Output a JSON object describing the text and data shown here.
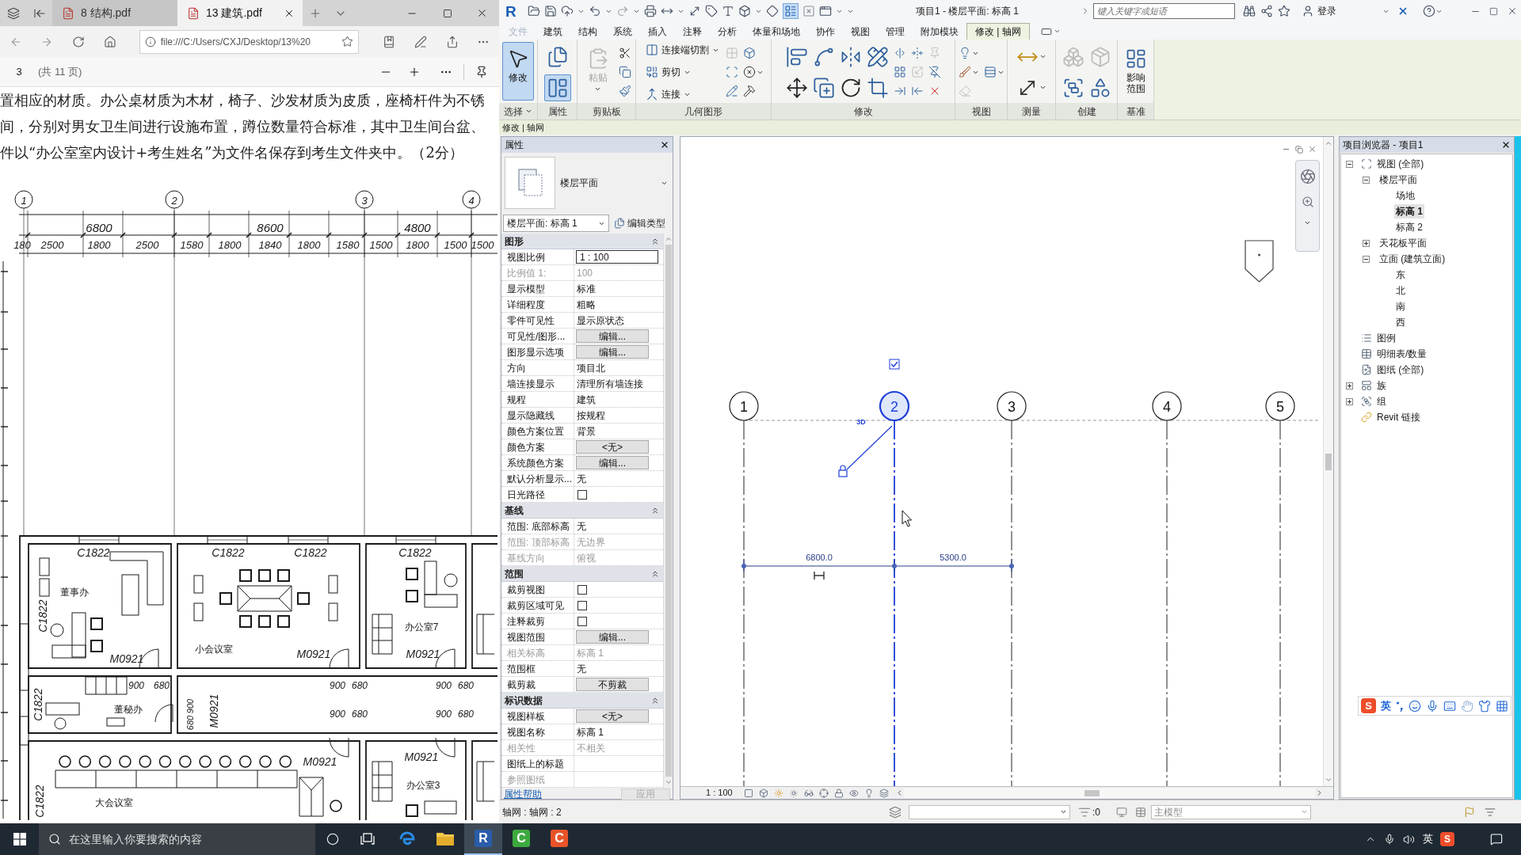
{
  "pdf_window": {
    "tabs": [
      {
        "label": "8 结构.pdf",
        "selected": false
      },
      {
        "label": "13 建筑.pdf",
        "selected": true
      }
    ],
    "address": "file:///C:/Users/CXJ/Desktop/13%20",
    "page": "3",
    "page_count": "(共 11 页)",
    "paragraph": [
      "置相应的材质。办公桌材质为木材，椅子、沙发材质为皮质，座椅杆件为不锈",
      "间，分别对男女卫生间进行设施布置，蹲位数量符合标准，其中卫生间台盆、",
      "件以“办公室室内设计+考生姓名”为文件名保存到考生文件夹中。（2分）"
    ],
    "plan": {
      "grid_bubbles": [
        "1",
        "2",
        "3",
        "4"
      ],
      "overall_dimensions": [
        "6800",
        "8600",
        "4800"
      ],
      "detail_dimensions": [
        "180",
        "2500",
        "1800",
        "2500",
        "1580",
        "1800",
        "1840",
        "1800",
        "1580",
        "1500",
        "1800",
        "1500",
        "1500"
      ],
      "labels": [
        "C1822",
        "C1822",
        "C1822",
        "C1822",
        "董事办",
        "C1822",
        "办公室7",
        "小会议室",
        "M0921",
        "M0921",
        "M0921",
        "900",
        "680",
        "900",
        "680",
        "900",
        "680",
        "C1822",
        "董秘办",
        "M0921",
        "900",
        "680",
        "900",
        "680",
        "900",
        "680",
        "M0921",
        "M0921",
        "办公室3",
        "大会议室",
        "C1822"
      ]
    }
  },
  "revit": {
    "logo": "R",
    "title": "项目1 - 楼层平面: 标高 1",
    "thin_lines_on": true,
    "search": {
      "placeholder": "键入关键字或短语"
    },
    "sign_in": "登录",
    "tabs": [
      {
        "label": "文件",
        "kind": "menu",
        "selected": false
      },
      {
        "label": "建筑",
        "kind": "tab",
        "selected": false
      },
      {
        "label": "结构",
        "kind": "tab",
        "selected": false
      },
      {
        "label": "系统",
        "kind": "tab",
        "selected": false
      },
      {
        "label": "插入",
        "kind": "tab",
        "selected": false
      },
      {
        "label": "注释",
        "kind": "tab",
        "selected": false
      },
      {
        "label": "分析",
        "kind": "tab",
        "selected": false
      },
      {
        "label": "体量和场地",
        "kind": "tab",
        "selected": false
      },
      {
        "label": "协作",
        "kind": "tab",
        "selected": false
      },
      {
        "label": "视图",
        "kind": "tab",
        "selected": false
      },
      {
        "label": "管理",
        "kind": "tab",
        "selected": false
      },
      {
        "label": "附加模块",
        "kind": "tab",
        "selected": false
      },
      {
        "label": "修改 | 轴网",
        "kind": "contextual",
        "selected": true
      }
    ],
    "panels": [
      {
        "label": "选择",
        "menu": true,
        "tools": [
          {
            "kind": "pointer",
            "label": "修改",
            "selected": true
          }
        ]
      },
      {
        "label": "属性",
        "menu": false,
        "tools": [
          {
            "kind": "type-properties",
            "selected": false
          },
          {
            "kind": "properties",
            "selected": true
          }
        ]
      },
      {
        "label": "剪贴板",
        "menu": false,
        "tools": [
          {
            "kind": "paste",
            "label": "粘贴",
            "disabled": true,
            "menu": true
          },
          {
            "kind": "cut",
            "disabled": false,
            "menu": false
          },
          {
            "kind": "copy",
            "disabled": false,
            "menu": false
          },
          {
            "kind": "match",
            "disabled": false,
            "menu": false
          }
        ]
      },
      {
        "label": "几何图形",
        "menu": false,
        "tools": [
          {
            "kind": "cope",
            "label": "连接端切割",
            "disabled": false,
            "menu": true
          },
          {
            "kind": "cut-geometry",
            "label": "剪切",
            "disabled": false,
            "menu": true
          },
          {
            "kind": "join",
            "label": "连接",
            "disabled": false,
            "menu": true
          },
          {
            "kind": "wall-joins",
            "disabled": true,
            "menu": false
          },
          {
            "kind": "split-face",
            "disabled": false,
            "menu": false
          },
          {
            "kind": "paint",
            "disabled": false,
            "menu": false
          },
          {
            "kind": "cube",
            "disabled": false,
            "menu": false
          },
          {
            "kind": "remove",
            "disabled": false,
            "menu": true
          },
          {
            "kind": "demolish",
            "disabled": false,
            "menu": false
          }
        ]
      },
      {
        "label": "修改",
        "menu": false,
        "tools": [
          {
            "kind": "align",
            "disabled": false,
            "menu": false
          },
          {
            "kind": "move",
            "disabled": false,
            "menu": false
          },
          {
            "kind": "offset",
            "disabled": false,
            "menu": false
          },
          {
            "kind": "copy-move",
            "disabled": false,
            "menu": false
          },
          {
            "kind": "mirror-axis",
            "disabled": false,
            "menu": false
          },
          {
            "kind": "rotate",
            "disabled": false,
            "menu": false
          },
          {
            "kind": "mirror-line",
            "disabled": false,
            "menu": false
          },
          {
            "kind": "trim",
            "disabled": false,
            "menu": false
          },
          {
            "kind": "split",
            "disabled": false,
            "menu": false
          },
          {
            "kind": "array",
            "disabled": false,
            "menu": false
          },
          {
            "kind": "trim-multi",
            "disabled": false,
            "menu": false
          },
          {
            "kind": "split-gap",
            "disabled": false,
            "menu": false
          },
          {
            "kind": "scale",
            "disabled": true,
            "menu": false
          },
          {
            "kind": "extend",
            "disabled": false,
            "menu": false
          },
          {
            "kind": "pin",
            "disabled": true,
            "menu": false
          },
          {
            "kind": "unpin",
            "disabled": false,
            "menu": false
          },
          {
            "kind": "delete",
            "disabled": false,
            "menu": false
          }
        ]
      },
      {
        "label": "视图",
        "menu": false,
        "tools": [
          {
            "kind": "bulb",
            "disabled": false,
            "menu": true
          },
          {
            "kind": "brush",
            "disabled": false,
            "menu": true
          },
          {
            "kind": "eraser",
            "disabled": true,
            "menu": false
          },
          {
            "kind": "lines",
            "disabled": false,
            "menu": true
          }
        ]
      },
      {
        "label": "测量",
        "menu": false,
        "tools": [
          {
            "kind": "measure",
            "disabled": false,
            "menu": true
          },
          {
            "kind": "dimension",
            "disabled": false,
            "menu": true
          }
        ]
      },
      {
        "label": "创建",
        "menu": false,
        "tools": [
          {
            "kind": "parts",
            "disabled": true,
            "menu": false
          },
          {
            "kind": "group",
            "disabled": false,
            "menu": false
          },
          {
            "kind": "assembly",
            "disabled": true,
            "menu": false
          },
          {
            "kind": "similar",
            "disabled": false,
            "menu": false
          }
        ]
      },
      {
        "label": "基准",
        "menu": false,
        "tools": [
          {
            "kind": "scope",
            "label": "影响范围",
            "disabled": false,
            "menu": false
          }
        ]
      }
    ],
    "context_label": "修改 | 轴网",
    "properties": {
      "title": "属性",
      "type_name": "楼层平面",
      "instance": "楼层平面: 标高 1",
      "edit_type": "编辑类型",
      "groups": [
        {
          "label": "图形",
          "expanded": true,
          "rows": [
            {
              "label": "视图比例",
              "kind": "input",
              "value": "1 : 100",
              "disabled": false
            },
            {
              "label": "比例值 1:",
              "kind": "text",
              "value": "100",
              "disabled": true
            },
            {
              "label": "显示模型",
              "kind": "text",
              "value": "标准",
              "disabled": false
            },
            {
              "label": "详细程度",
              "kind": "text",
              "value": "粗略",
              "disabled": false
            },
            {
              "label": "零件可见性",
              "kind": "text",
              "value": "显示原状态",
              "disabled": false
            },
            {
              "label": "可见性/图形...",
              "kind": "button",
              "value": "编辑...",
              "disabled": false
            },
            {
              "label": "图形显示选项",
              "kind": "button",
              "value": "编辑...",
              "disabled": false
            },
            {
              "label": "方向",
              "kind": "text",
              "value": "项目北",
              "disabled": false
            },
            {
              "label": "墙连接显示",
              "kind": "text",
              "value": "清理所有墙连接",
              "disabled": false
            },
            {
              "label": "规程",
              "kind": "text",
              "value": "建筑",
              "disabled": false
            },
            {
              "label": "显示隐藏线",
              "kind": "text",
              "value": "按规程",
              "disabled": false
            },
            {
              "label": "颜色方案位置",
              "kind": "text",
              "value": "背景",
              "disabled": false
            },
            {
              "label": "颜色方案",
              "kind": "button",
              "value": "<无>",
              "disabled": false
            },
            {
              "label": "系统颜色方案",
              "kind": "button",
              "value": "编辑...",
              "disabled": false
            },
            {
              "label": "默认分析显示...",
              "kind": "text",
              "value": "无",
              "disabled": false
            },
            {
              "label": "日光路径",
              "kind": "checkbox",
              "checked": false,
              "disabled": false
            }
          ]
        },
        {
          "label": "基线",
          "expanded": true,
          "rows": [
            {
              "label": "范围: 底部标高",
              "kind": "text",
              "value": "无",
              "disabled": false
            },
            {
              "label": "范围: 顶部标高",
              "kind": "text",
              "value": "无边界",
              "disabled": true
            },
            {
              "label": "基线方向",
              "kind": "text",
              "value": "俯视",
              "disabled": true
            }
          ]
        },
        {
          "label": "范围",
          "expanded": true,
          "rows": [
            {
              "label": "裁剪视图",
              "kind": "checkbox",
              "checked": false,
              "disabled": false
            },
            {
              "label": "裁剪区域可见",
              "kind": "checkbox",
              "checked": false,
              "disabled": false
            },
            {
              "label": "注释裁剪",
              "kind": "checkbox",
              "checked": false,
              "disabled": false
            },
            {
              "label": "视图范围",
              "kind": "button",
              "value": "编辑...",
              "disabled": false
            },
            {
              "label": "相关标高",
              "kind": "text",
              "value": "标高 1",
              "disabled": true
            },
            {
              "label": "范围框",
              "kind": "text",
              "value": "无",
              "disabled": false
            },
            {
              "label": "截剪裁",
              "kind": "button",
              "value": "不剪裁",
              "disabled": false
            }
          ]
        },
        {
          "label": "标识数据",
          "expanded": true,
          "rows": [
            {
              "label": "视图样板",
              "kind": "button",
              "value": "<无>",
              "disabled": false
            },
            {
              "label": "视图名称",
              "kind": "text",
              "value": "标高 1",
              "disabled": false
            },
            {
              "label": "相关性",
              "kind": "text",
              "value": "不相关",
              "disabled": true
            },
            {
              "label": "图纸上的标题",
              "kind": "text",
              "disabled": false
            },
            {
              "label": "参照图纸",
              "kind": "text",
              "disabled": true
            }
          ]
        }
      ],
      "help": "属性帮助",
      "apply": {
        "label": "应用",
        "disabled": true
      }
    },
    "view": {
      "grids": [
        {
          "label": "1",
          "selected": false
        },
        {
          "label": "2",
          "selected": true
        },
        {
          "label": "3",
          "selected": false
        },
        {
          "label": "4",
          "selected": false
        },
        {
          "label": "5",
          "selected": false
        }
      ],
      "extent_label": "3D",
      "show_bubble": true,
      "temp_dimensions": [
        "6800.0",
        "5300.0"
      ],
      "scale": "1 : 100"
    },
    "browser": {
      "title": "项目浏览器 - 项目1",
      "items": [
        {
          "label": "视图 (全部)",
          "kind": "views",
          "expanded": true,
          "selected": false,
          "children": [
            {
              "label": "楼层平面",
              "expanded": true,
              "selected": false,
              "children": [
                {
                  "label": "场地",
                  "selected": false
                },
                {
                  "label": "标高 1",
                  "selected": true
                },
                {
                  "label": "标高 2",
                  "selected": false
                }
              ]
            },
            {
              "label": "天花板平面",
              "expanded": false,
              "selected": false
            },
            {
              "label": "立面 (建筑立面)",
              "expanded": true,
              "selected": false,
              "children": [
                {
                  "label": "东",
                  "selected": false
                },
                {
                  "label": "北",
                  "selected": false
                },
                {
                  "label": "南",
                  "selected": false
                },
                {
                  "label": "西",
                  "selected": false
                }
              ]
            }
          ]
        },
        {
          "label": "图例",
          "kind": "legends",
          "selected": false
        },
        {
          "label": "明细表/数量",
          "kind": "schedules",
          "selected": false
        },
        {
          "label": "图纸 (全部)",
          "kind": "sheets",
          "selected": false
        },
        {
          "label": "族",
          "kind": "families",
          "expanded": false,
          "selected": false
        },
        {
          "label": "组",
          "kind": "groups",
          "expanded": false,
          "selected": false
        },
        {
          "label": "Revit 链接",
          "kind": "links",
          "selected": false
        }
      ]
    },
    "status": {
      "selection": "轴网 : 轴网 : 2",
      "worksets": ":0",
      "model": "主模型"
    }
  },
  "ime_toolbar": {
    "logo": "S",
    "mode": "英"
  },
  "taskbar": {
    "search_placeholder": "在这里输入你要搜索的内容",
    "apps": [
      {
        "kind": "browser",
        "selected": false
      },
      {
        "kind": "files",
        "selected": false
      },
      {
        "kind": "letter",
        "letter": "R",
        "color": "#2a5caa",
        "selected": true
      },
      {
        "kind": "letter",
        "letter": "C",
        "color": "#3daa3f",
        "selected": false
      },
      {
        "kind": "letter",
        "letter": "C",
        "color": "#e9532a",
        "selected": false
      }
    ],
    "tray": {
      "ime_mode": "英",
      "ime_logo": "S"
    }
  }
}
